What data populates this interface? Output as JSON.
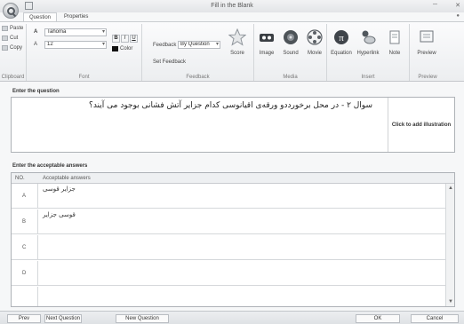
{
  "window": {
    "title": "Fill in the Blank",
    "minimize": "─",
    "close": "✕"
  },
  "ribbon": {
    "tabs": [
      "Question",
      "Properties"
    ],
    "clipboard": {
      "paste": "Paste",
      "cut": "Cut",
      "copy": "Copy",
      "label": "Clipboard"
    },
    "font": {
      "name": "Tahoma",
      "size": "12",
      "bold": "B",
      "italic": "I",
      "underline": "U",
      "color": "Color",
      "label": "Font"
    },
    "feedback": {
      "feedback_label": "Feedback",
      "mode": "By Question",
      "set_feedback": "Set Feedback",
      "score": "Score",
      "label": "Feedback"
    },
    "media": {
      "image": "Image",
      "sound": "Sound",
      "movie": "Movie",
      "label": "Media"
    },
    "insert": {
      "equation": "Equation",
      "hyperlink": "Hyperlink",
      "note": "Note",
      "label": "Insert"
    },
    "preview": {
      "preview": "Preview",
      "label": "Preview"
    }
  },
  "question": {
    "section_label": "Enter the question",
    "text": "سوال ۲ - در محل برخورددو ورقه‌ی اقیانوسی کدام جزایر آتش فشانی بوجود می آیند؟",
    "illustration": "Click to add illustration"
  },
  "answers": {
    "section_label": "Enter the acceptable answers",
    "columns": [
      "NO.",
      "Acceptable answers"
    ],
    "rows": [
      {
        "no": "A",
        "answer": "جزایر قوسی"
      },
      {
        "no": "B",
        "answer": "قوسی جزایر"
      },
      {
        "no": "C",
        "answer": ""
      },
      {
        "no": "D",
        "answer": ""
      }
    ]
  },
  "footer": {
    "prev": "Prev Question",
    "next": "Next Question",
    "new": "New Question",
    "ok": "OK",
    "cancel": "Cancel"
  }
}
